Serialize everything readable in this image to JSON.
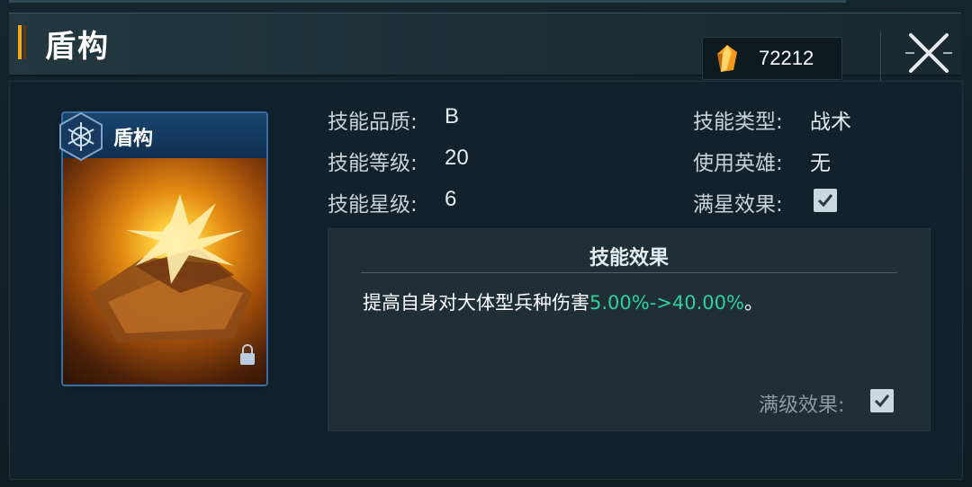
{
  "header": {
    "title": "盾构",
    "currency": {
      "icon": "orange-crystal-icon",
      "value": "72212"
    },
    "close_icon": "close-icon"
  },
  "card": {
    "name": "盾构",
    "emblem_icon": "hexagon-emblem-icon",
    "lock_icon": "lock-icon"
  },
  "info": {
    "quality_label": "技能品质:",
    "quality_value": "B",
    "level_label": "技能等级:",
    "level_value": "20",
    "star_label": "技能星级:",
    "star_value": "6",
    "type_label": "技能类型:",
    "type_value": "战术",
    "hero_label": "使用英雄:",
    "hero_value": "无",
    "fullstar_label": "满星效果:",
    "fullstar_checked": true
  },
  "effect": {
    "title": "技能效果",
    "text_prefix": "提高自身对大体型兵种伤害",
    "text_highlight": "5.00%->40.00%",
    "text_suffix": "。",
    "maxlevel_label": "满级效果:",
    "maxlevel_checked": true
  },
  "colors": {
    "highlight": "#2fd19a",
    "accent": "#f0a81c",
    "card_border": "#3b6c9e"
  }
}
